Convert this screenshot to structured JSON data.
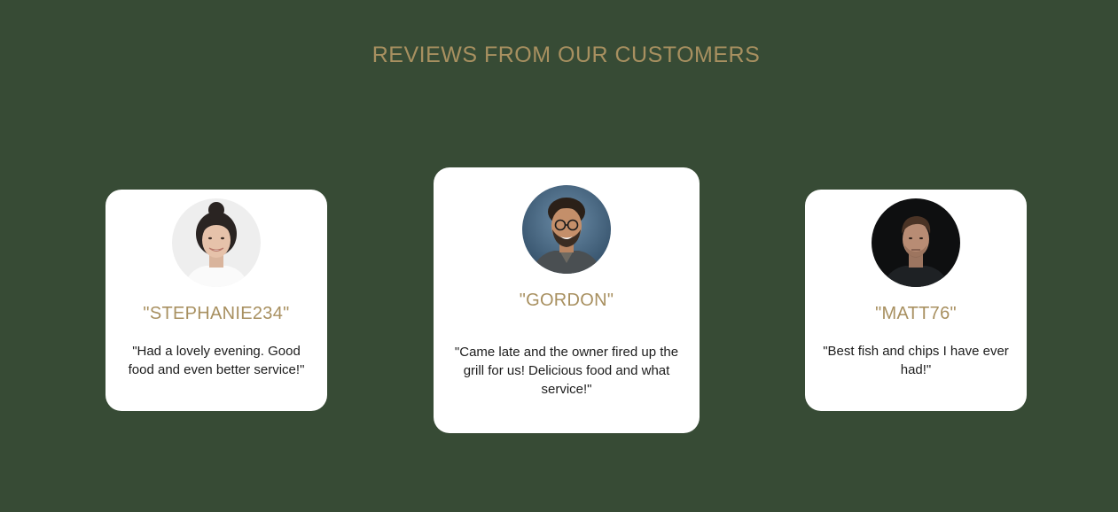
{
  "section": {
    "title": "REVIEWS FROM OUR CUSTOMERS"
  },
  "reviews": [
    {
      "name": "\"STEPHANIE234\"",
      "text": "\"Had a lovely evening. Good food and even better service!\"",
      "avatar": "woman-portrait-photo"
    },
    {
      "name": "\"GORDON\"",
      "text": "\"Came late and the owner fired up the grill for us! Delicious food and what service!\"",
      "avatar": "man-with-glasses-portrait-photo"
    },
    {
      "name": "\"MATT76\"",
      "text": "\"Best fish and chips I have ever had!\"",
      "avatar": "young-man-portrait-photo"
    }
  ],
  "colors": {
    "background": "#374B35",
    "accent": "#A89060",
    "card": "#FFFFFF",
    "text": "#1C1C1C"
  }
}
